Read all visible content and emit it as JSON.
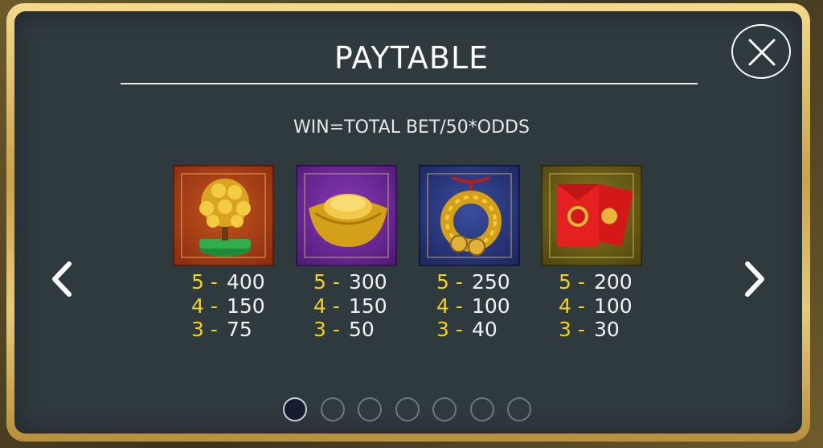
{
  "title": "PAYTABLE",
  "formula": "WIN=TOTAL BET/50*ODDS",
  "colors": {
    "panel": "#2f3a3f",
    "count_text": "#f2d21a",
    "value_text": "#f2f2f2",
    "frame": "#d4b05a"
  },
  "symbols": [
    {
      "icon": "money-tree-icon",
      "pays": [
        {
          "count": "5 -",
          "value": "400"
        },
        {
          "count": "4 -",
          "value": "150"
        },
        {
          "count": "3 -",
          "value": "75"
        }
      ]
    },
    {
      "icon": "gold-ingot-icon",
      "pays": [
        {
          "count": "5 -",
          "value": "300"
        },
        {
          "count": "4 -",
          "value": "150"
        },
        {
          "count": "3 -",
          "value": "50"
        }
      ]
    },
    {
      "icon": "coin-string-icon",
      "pays": [
        {
          "count": "5 -",
          "value": "250"
        },
        {
          "count": "4 -",
          "value": "100"
        },
        {
          "count": "3 -",
          "value": "40"
        }
      ]
    },
    {
      "icon": "red-envelope-icon",
      "pays": [
        {
          "count": "5 -",
          "value": "200"
        },
        {
          "count": "4 -",
          "value": "100"
        },
        {
          "count": "3 -",
          "value": "30"
        }
      ]
    }
  ],
  "pagination": {
    "pages": 7,
    "current_page": 1
  }
}
